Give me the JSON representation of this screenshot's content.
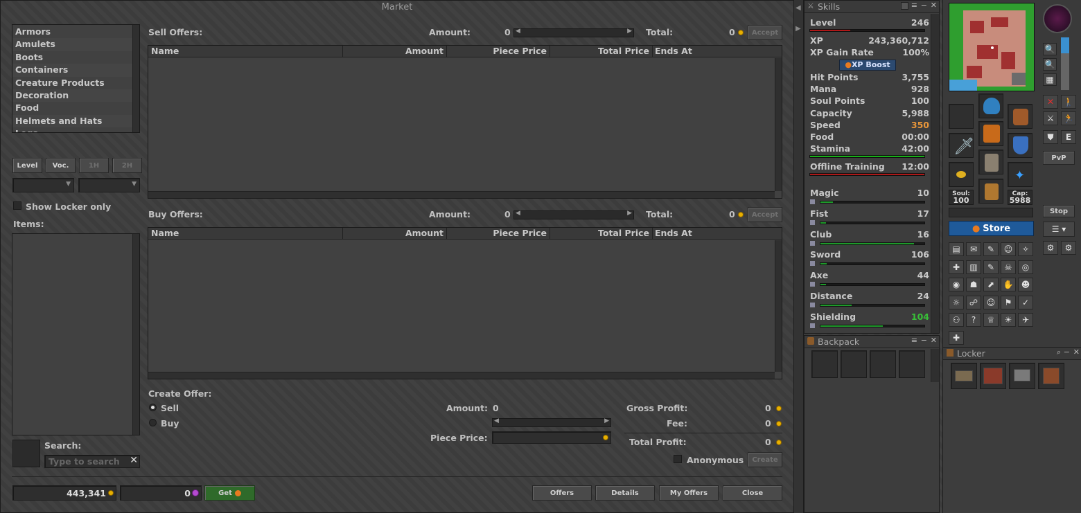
{
  "market": {
    "title": "Market",
    "categories": [
      "Armors",
      "Amulets",
      "Boots",
      "Containers",
      "Creature Products",
      "Decoration",
      "Food",
      "Helmets and Hats",
      "Legs"
    ],
    "filters": {
      "level": "Level",
      "voc": "Voc.",
      "one_h": "1H",
      "two_h": "2H"
    },
    "show_locker_only": "Show Locker only",
    "items_label": "Items:",
    "search_label": "Search:",
    "search_placeholder": "Type to search",
    "sell": {
      "label": "Sell Offers:",
      "amount_label": "Amount:",
      "amount": "0",
      "total_label": "Total:",
      "total": "0",
      "accept": "Accept"
    },
    "buy": {
      "label": "Buy Offers:",
      "amount_label": "Amount:",
      "amount": "0",
      "total_label": "Total:",
      "total": "0",
      "accept": "Accept"
    },
    "columns": [
      "Name",
      "Amount",
      "Piece Price",
      "Total Price",
      "Ends At"
    ],
    "create": {
      "label": "Create Offer:",
      "sell": "Sell",
      "buy": "Buy",
      "amount_label": "Amount:",
      "amount": "0",
      "piece_price_label": "Piece Price:",
      "gross_label": "Gross Profit:",
      "gross": "0",
      "fee_label": "Fee:",
      "fee": "0",
      "total_label": "Total Profit:",
      "total": "0",
      "anonymous": "Anonymous",
      "create_btn": "Create"
    },
    "balance": "443,341",
    "coins": "0",
    "get_btn": "Get",
    "buttons": {
      "offers": "Offers",
      "details": "Details",
      "my_offers": "My Offers",
      "close": "Close"
    }
  },
  "skills": {
    "title": "Skills",
    "level_label": "Level",
    "level": "246",
    "xp_label": "XP",
    "xp": "243,360,712",
    "xp_rate_label": "XP Gain Rate",
    "xp_rate": "100%",
    "xp_boost": "XP Boost",
    "stats": [
      {
        "label": "Hit Points",
        "value": "3,755"
      },
      {
        "label": "Mana",
        "value": "928"
      },
      {
        "label": "Soul Points",
        "value": "100"
      },
      {
        "label": "Capacity",
        "value": "5,988"
      },
      {
        "label": "Speed",
        "value": "350"
      },
      {
        "label": "Food",
        "value": "00:00"
      },
      {
        "label": "Stamina",
        "value": "42:00"
      }
    ],
    "offline_label": "Offline Training",
    "offline": "12:00",
    "skills": [
      {
        "label": "Magic",
        "value": "10",
        "progress": 0.12
      },
      {
        "label": "Fist",
        "value": "17",
        "progress": 0.05
      },
      {
        "label": "Club",
        "value": "16",
        "progress": 0.9
      },
      {
        "label": "Sword",
        "value": "106",
        "progress": 0.06
      },
      {
        "label": "Axe",
        "value": "44",
        "progress": 0.05
      },
      {
        "label": "Distance",
        "value": "24",
        "progress": 0.3
      },
      {
        "label": "Shielding",
        "value": "104",
        "progress": 0.6
      }
    ],
    "colors": {
      "speed": "#e8963a",
      "shielding": "#38c038",
      "health": "#c01818",
      "stamina": "#18b018"
    }
  },
  "backpack": {
    "title": "Backpack"
  },
  "locker": {
    "title": "Locker",
    "items": [
      "depot",
      "stash",
      "inbox",
      "market"
    ]
  },
  "equipment": {
    "soul_label": "Soul:",
    "soul": "100",
    "cap_label": "Cap:",
    "cap": "5988"
  },
  "side": {
    "stop": "Stop",
    "pvp": "PvP",
    "store": "Store",
    "e": "E"
  }
}
